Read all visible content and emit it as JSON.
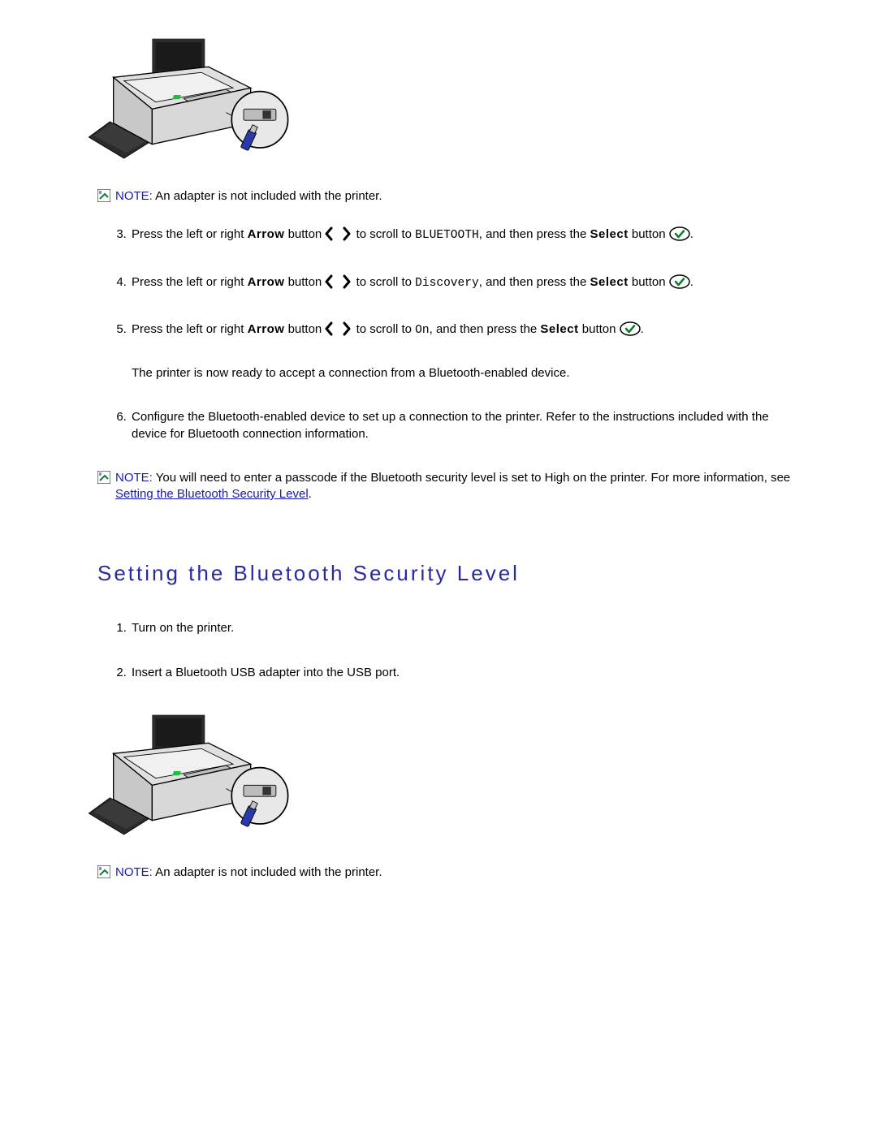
{
  "notes": {
    "note_label": "NOTE:",
    "adapter_not_included": " An adapter is not included with the printer.",
    "passcode_prefix": " You will need to enter a passcode if the Bluetooth security level is set to High on the printer. For more information, see ",
    "passcode_link": "Setting the Bluetooth Security Level",
    "passcode_suffix": "."
  },
  "steps_top": {
    "s3_a": "Press the left or right ",
    "s3_b": "Arrow",
    "s3_c": " button ",
    "s3_d": " to scroll to ",
    "s3_mono": "BLUETOOTH",
    "s3_e": ", and then press the ",
    "s3_f": "Select",
    "s3_g": " button ",
    "s3_h": ".",
    "s4_a": "Press the left or right ",
    "s4_b": "Arrow",
    "s4_c": " button ",
    "s4_d": " to scroll to ",
    "s4_mono": "Discovery",
    "s4_e": ", and then press the ",
    "s4_f": "Select",
    "s4_g": " button ",
    "s4_h": ".",
    "s5_a": "Press the left or right ",
    "s5_b": "Arrow",
    "s5_c": " button ",
    "s5_d": " to scroll to ",
    "s5_mono": "On",
    "s5_e": ", and then press the ",
    "s5_f": "Select",
    "s5_g": " button ",
    "s5_h": ".",
    "s5_cont": "The printer is now ready to accept a connection from a Bluetooth-enabled device.",
    "s6": "Configure the Bluetooth-enabled device to set up a connection to the printer. Refer to the instructions included with the device for Bluetooth connection information."
  },
  "heading": "Setting the Bluetooth Security Level",
  "steps_bottom": {
    "s1": "Turn on the printer.",
    "s2": "Insert a Bluetooth USB adapter into the USB port."
  }
}
